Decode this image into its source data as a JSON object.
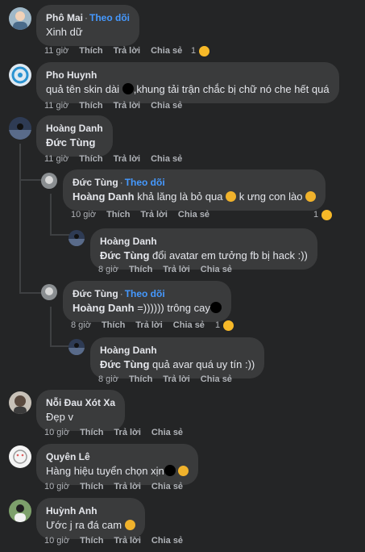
{
  "comments": [
    {
      "name": "Phô Mai",
      "follow": "Theo dõi",
      "text": "Xinh dữ",
      "time": "11 giờ",
      "like": "Thích",
      "reply": "Trả lời",
      "share": "Chia sẻ",
      "reactions": "1"
    },
    {
      "name": "Pho Huynh",
      "text_a": "quả tên skin dài",
      "text_b": "khung tải trận chắc bị chữ nó che hết quá",
      "time": "11 giờ",
      "like": "Thích",
      "reply": "Trả lời",
      "share": "Chia sẻ"
    },
    {
      "name": "Hoàng Danh",
      "text": "Đức Tùng",
      "time": "11 giờ",
      "like": "Thích",
      "reply": "Trả lời",
      "share": "Chia sẻ",
      "replies": [
        {
          "name": "Đức Tùng",
          "follow": "Theo dõi",
          "mention": "Hoàng Danh",
          "text_a": "khả lăng là bỏ qua",
          "text_b": "k ưng con lào",
          "time": "10 giờ",
          "like": "Thích",
          "reply": "Trả lời",
          "share": "Chia sẻ",
          "reactions": "1",
          "sub": {
            "name": "Hoàng Danh",
            "mention": "Đức Tùng",
            "text": "đổi avatar em tưởng fb bị hack :))",
            "time": "8 giờ",
            "like": "Thích",
            "reply": "Trả lời",
            "share": "Chia sẻ"
          }
        },
        {
          "name": "Đức Tùng",
          "follow": "Theo dõi",
          "mention": "Hoàng Danh",
          "text": "=)))))) trông cay",
          "time": "8 giờ",
          "like": "Thích",
          "reply": "Trả lời",
          "share": "Chia sẻ",
          "reactions": "1",
          "sub": {
            "name": "Hoàng Danh",
            "mention": "Đức Tùng",
            "text": "quả avar quá uy tín :))",
            "time": "8 giờ",
            "like": "Thích",
            "reply": "Trả lời",
            "share": "Chia sẻ"
          }
        }
      ]
    },
    {
      "name": "Nỗi Đau Xót Xa",
      "text": "Đẹp v",
      "time": "10 giờ",
      "like": "Thích",
      "reply": "Trả lời",
      "share": "Chia sẻ"
    },
    {
      "name": "Quyên Lê",
      "text": "Hàng hiệu tuyển chọn xịn",
      "time": "10 giờ",
      "like": "Thích",
      "reply": "Trả lời",
      "share": "Chia sẻ"
    },
    {
      "name": "Huỳnh Anh",
      "text": "Ước j ra đá cam",
      "time": "10 giờ",
      "like": "Thích",
      "reply": "Trả lời",
      "share": "Chia sẻ"
    }
  ],
  "colors": {
    "bg": "#242526",
    "bubble": "#3a3b3c",
    "link": "#4599ff",
    "muted": "#b0b3b8"
  }
}
